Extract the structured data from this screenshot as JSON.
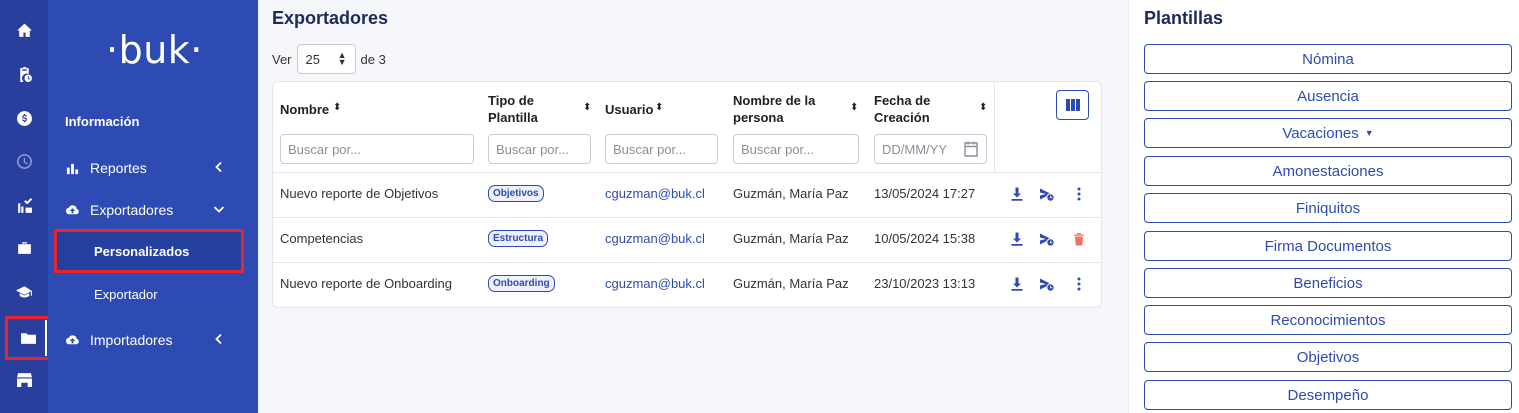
{
  "rail": {
    "items": [
      {
        "icon": "home-icon"
      },
      {
        "icon": "clipboard-clock-icon"
      },
      {
        "icon": "dollar-icon"
      },
      {
        "icon": "clock-icon"
      },
      {
        "icon": "checklist-icon"
      },
      {
        "icon": "briefcase-icon"
      },
      {
        "icon": "graduation-cap-icon"
      },
      {
        "icon": "folder-icon"
      },
      {
        "icon": "store-icon"
      }
    ]
  },
  "nav": {
    "logo": "·buk·",
    "heading": "Información",
    "reportes": "Reportes",
    "exportadores": "Exportadores",
    "personalizados": "Personalizados",
    "exportador": "Exportador",
    "importadores": "Importadores"
  },
  "main": {
    "title": "Exportadores",
    "ver_label": "Ver",
    "page_size": "25",
    "de_label": "de 3",
    "columns": {
      "nombre": "Nombre",
      "tipo_line1": "Tipo de",
      "tipo_line2": "Plantilla",
      "usuario": "Usuario",
      "persona_line1": "Nombre de la",
      "persona_line2": "persona",
      "fecha_line1": "Fecha de",
      "fecha_line2": "Creación"
    },
    "filters": {
      "nombre": "Buscar por...",
      "tipo": "Buscar por...",
      "usuario": "Buscar por...",
      "persona": "Buscar por...",
      "fecha": "DD/MM/YY"
    },
    "rows": [
      {
        "nombre": "Nuevo reporte de Objetivos",
        "tipo": "Objetivos",
        "usuario": "cguzman@buk.cl",
        "persona": "Guzmán, María Paz",
        "fecha": "13/05/2024 17:27"
      },
      {
        "nombre": "Competencias",
        "tipo": "Estructura",
        "usuario": "cguzman@buk.cl",
        "persona": "Guzmán, María Paz",
        "fecha": "10/05/2024 15:38"
      },
      {
        "nombre": "Nuevo reporte de Onboarding",
        "tipo": "Onboarding",
        "usuario": "cguzman@buk.cl",
        "persona": "Guzmán, María Paz",
        "fecha": "23/10/2023 13:13"
      }
    ]
  },
  "side": {
    "title": "Plantillas",
    "buttons": [
      "Nómina",
      "Ausencia",
      "Vacaciones",
      "Amonestaciones",
      "Finiquitos",
      "Firma Documentos",
      "Beneficios",
      "Reconocimientos",
      "Objetivos",
      "Desempeño"
    ]
  },
  "colors": {
    "rail": "#2a3f9d",
    "nav": "#2e4bb3",
    "accent": "#2e4bb3",
    "highlight": "#e8242c",
    "delete": "#f07067"
  }
}
